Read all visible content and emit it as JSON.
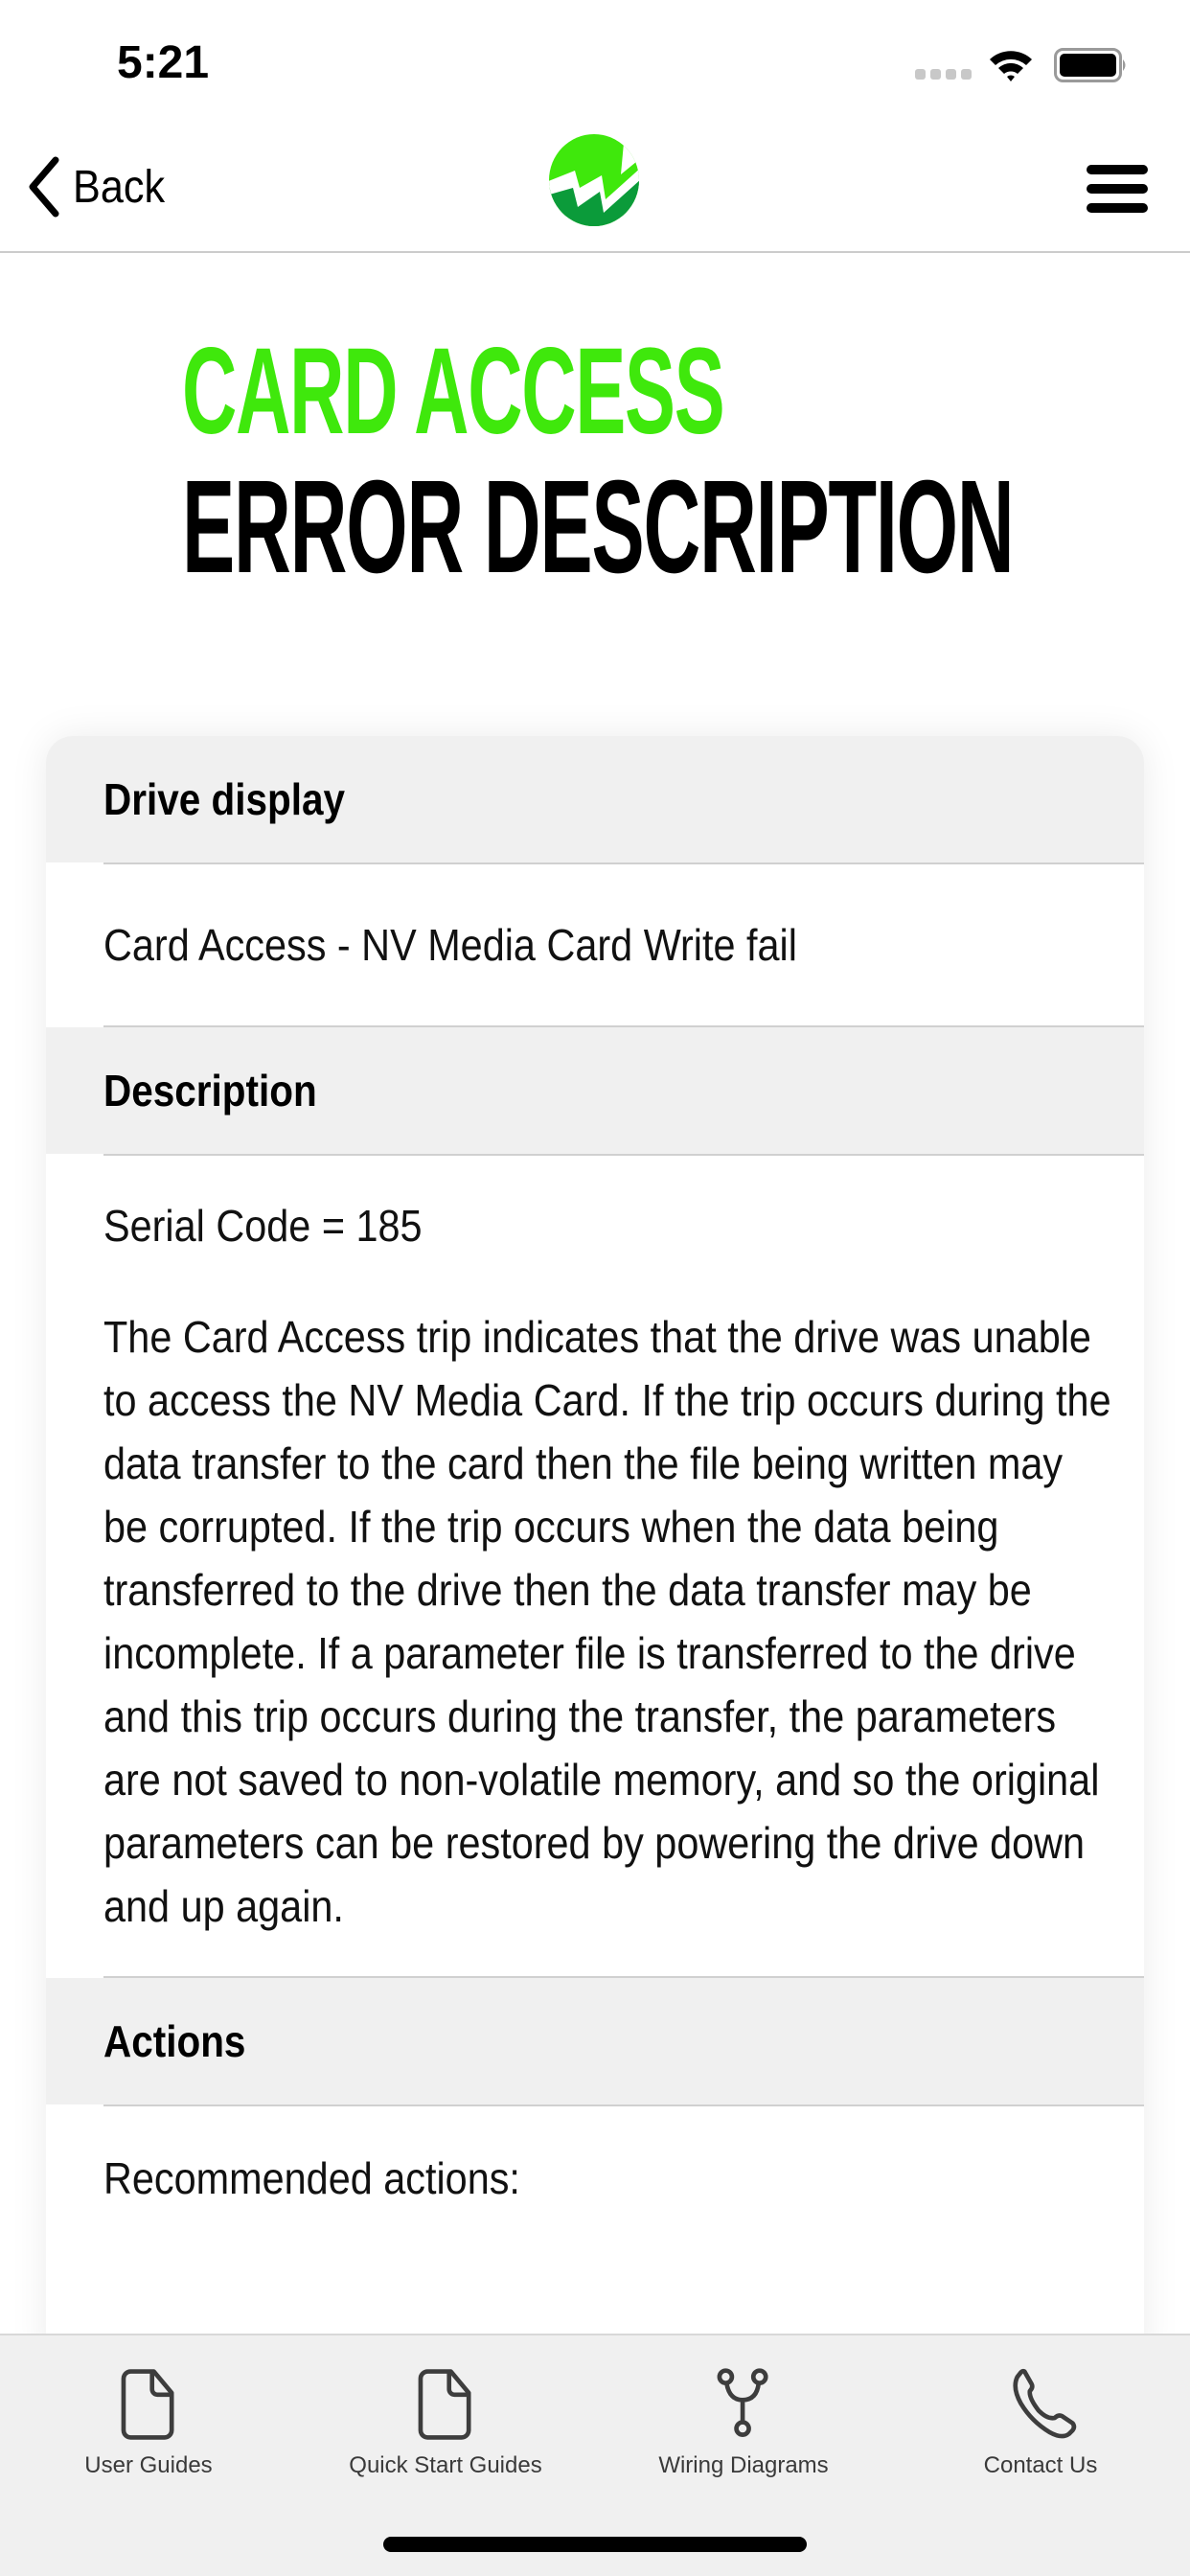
{
  "status_bar": {
    "time": "5:21",
    "icons": [
      "signal-icon",
      "wifi-icon",
      "battery-icon"
    ]
  },
  "nav": {
    "back_label": "Back",
    "back_icon": "chevron-left-icon",
    "logo": "brand-logo",
    "menu_icon": "hamburger-menu-icon"
  },
  "title": {
    "line1": "CARD ACCESS",
    "line2": "ERROR DESCRIPTION"
  },
  "colors": {
    "accent_green": "#3FE80C",
    "logo_dark_green": "#0B9B3A",
    "section_header_bg": "#F0F0F0",
    "tab_bar_bg": "#F0F0F0"
  },
  "sections": [
    {
      "header": "Drive display",
      "body": [
        "Card Access - NV Media Card Write fail"
      ]
    },
    {
      "header": "Description",
      "body": [
        "Serial Code = 185",
        "The Card Access trip indicates that the drive was unable to access the NV Media Card. If the trip occurs during the data transfer to the card then the file being written may be corrupted. If the trip occurs when the data being transferred to the drive then the data transfer may be incomplete. If a parameter file is transferred to the drive and this trip occurs during the transfer, the parameters are not saved to non-volatile memory, and so the original parameters can be restored by powering the drive down and up again."
      ]
    },
    {
      "header": "Actions",
      "body": [
        "Recommended actions:"
      ]
    }
  ],
  "tab_bar": {
    "tabs": [
      {
        "label": "User Guides",
        "icon": "document-icon"
      },
      {
        "label": "Quick Start Guides",
        "icon": "document-icon"
      },
      {
        "label": "Wiring Diagrams",
        "icon": "wiring-icon"
      },
      {
        "label": "Contact Us",
        "icon": "phone-icon"
      }
    ]
  }
}
